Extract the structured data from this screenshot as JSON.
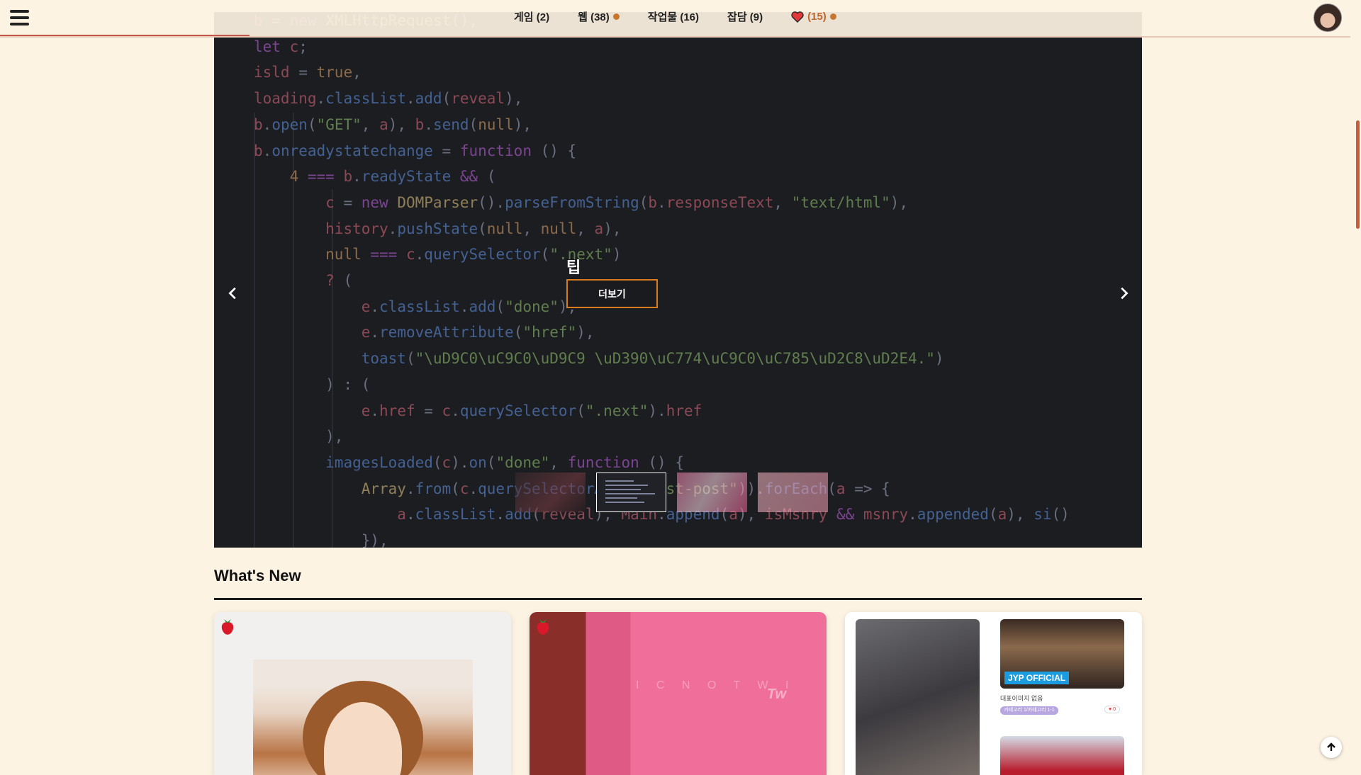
{
  "nav": {
    "items": [
      {
        "label": "게임 (2)",
        "dot": false
      },
      {
        "label": "웹 (38)",
        "dot": true
      },
      {
        "label": "작업물 (16)",
        "dot": false
      },
      {
        "label": "잡담 (9)",
        "dot": false
      }
    ],
    "favorites": {
      "label": "(15)",
      "icon": "heart-icon",
      "dot": true
    }
  },
  "hero": {
    "slide_title": "팁",
    "more_label": "더보기",
    "code_lines": [
      "b = new XMLHttpRequest(),",
      "let c;",
      "isld = true,",
      "loading.classList.add(reveal),",
      "b.open(\"GET\", a), b.send(null),",
      "b.onreadystatechange = function () {",
      "    4 === b.readyState && (",
      "        c = new DOMParser().parseFromString(b.responseText, \"text/html\"),",
      "        history.pushState(null, null, a),",
      "        null === c.querySelector(\".next\")",
      "        ? (",
      "            e.classList.add(\"done\"),",
      "            e.removeAttribute(\"href\"),",
      "            toast(\"\\uD9C0\\uC9C0\\uD9C9 \\uD390\\uC774\\uC9C0\\uC785\\uD2C8\\uD2E4.\")",
      "        ) : (",
      "            e.href = c.querySelector(\".next\").href",
      "        ),",
      "        imagesLoaded(c).on(\"done\", function () {",
      "            Array.from(c.querySelectorAll(\".list-post\")).forEach(a => {",
      "                a.classList.add(reveal), Main.append(a), isMsnry && msnry.appended(a), si()",
      "            }),"
    ],
    "thumbnails_count": 4,
    "active_thumbnail": 2
  },
  "whats_new": {
    "title": "What's New",
    "card3": {
      "badge": "JYP OFFICIAL",
      "caption": "대표이미지 없음",
      "pill": "카테고리 1/카테고리 1-1",
      "likes": "♥ 0"
    },
    "card2_text": "I C N O T W I",
    "card2_logo": "Tw"
  },
  "colors": {
    "background": "#fdf3e3",
    "accent": "#c8762f",
    "progress": "#c2574c",
    "hero_bg": "#1c1d21",
    "button_border": "#d97b1f"
  }
}
